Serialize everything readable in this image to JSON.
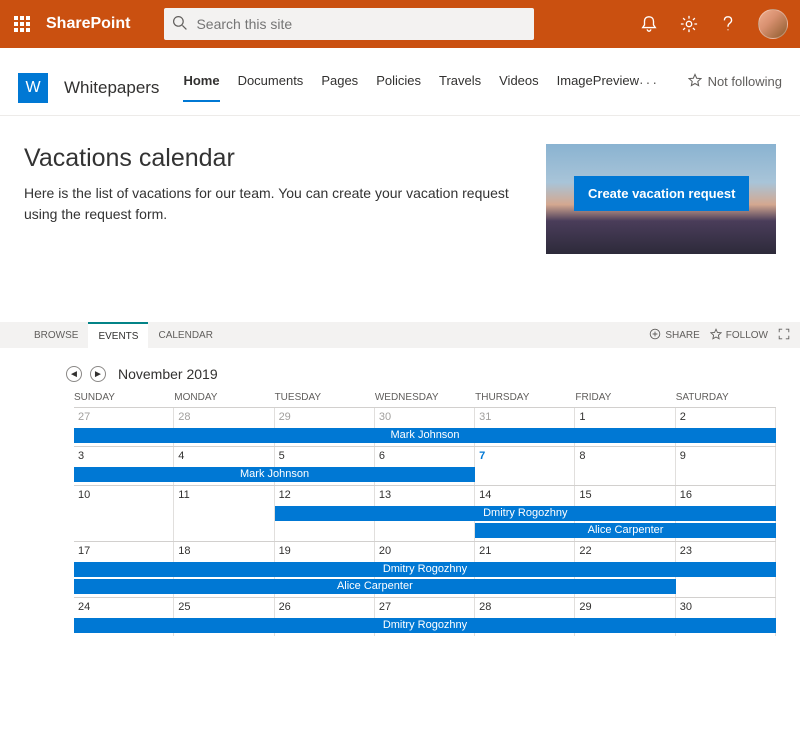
{
  "header": {
    "product": "SharePoint",
    "search_placeholder": "Search this site"
  },
  "site": {
    "logo_letter": "W",
    "title": "Whitepapers",
    "nav": [
      "Home",
      "Documents",
      "Pages",
      "Policies",
      "Travels",
      "Videos",
      "ImagePreview"
    ],
    "not_following": "Not following"
  },
  "page": {
    "title": "Vacations calendar",
    "description": "Here is the list of vacations for our team. You can create your vacation request using the request form.",
    "cta": "Create vacation request"
  },
  "ribbon": {
    "tabs": [
      "BROWSE",
      "EVENTS",
      "CALENDAR"
    ],
    "share": "SHARE",
    "follow": "FOLLOW"
  },
  "calendar": {
    "month": "November 2019",
    "day_headers": [
      "SUNDAY",
      "MONDAY",
      "TUESDAY",
      "WEDNESDAY",
      "THURSDAY",
      "FRIDAY",
      "SATURDAY"
    ],
    "weeks": [
      {
        "days": [
          "27",
          "28",
          "29",
          "30",
          "31",
          "1",
          "2"
        ],
        "prev_month_until": 5,
        "events": [
          {
            "label": "Mark Johnson",
            "start": 0,
            "end": 7,
            "row": 0
          }
        ]
      },
      {
        "days": [
          "3",
          "4",
          "5",
          "6",
          "7",
          "8",
          "9"
        ],
        "today_index": 4,
        "events": [
          {
            "label": "Mark Johnson",
            "start": 0,
            "end": 4,
            "row": 0
          }
        ]
      },
      {
        "days": [
          "10",
          "11",
          "12",
          "13",
          "14",
          "15",
          "16"
        ],
        "events": [
          {
            "label": "Dmitry Rogozhny",
            "start": 2,
            "end": 7,
            "row": 0
          },
          {
            "label": "Alice Carpenter",
            "start": 4,
            "end": 7,
            "row": 1
          }
        ]
      },
      {
        "days": [
          "17",
          "18",
          "19",
          "20",
          "21",
          "22",
          "23"
        ],
        "events": [
          {
            "label": "Dmitry Rogozhny",
            "start": 0,
            "end": 7,
            "row": 0
          },
          {
            "label": "Alice Carpenter",
            "start": 0,
            "end": 6,
            "row": 1
          }
        ]
      },
      {
        "days": [
          "24",
          "25",
          "26",
          "27",
          "28",
          "29",
          "30"
        ],
        "events": [
          {
            "label": "Dmitry Rogozhny",
            "start": 0,
            "end": 7,
            "row": 0
          }
        ]
      }
    ]
  }
}
